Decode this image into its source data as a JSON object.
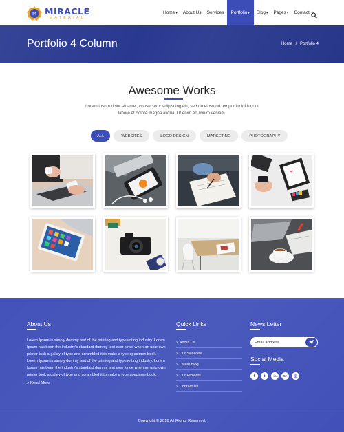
{
  "brand": {
    "name": "MIRACLE",
    "tagline": "MATERIAL",
    "badge_letter": "M"
  },
  "nav": {
    "items": [
      {
        "label": "Home",
        "caret": true,
        "active": false
      },
      {
        "label": "About Us",
        "caret": false,
        "active": false
      },
      {
        "label": "Services",
        "caret": false,
        "active": false
      },
      {
        "label": "Portfolio",
        "caret": true,
        "active": true
      },
      {
        "label": "Blog",
        "caret": true,
        "active": false
      },
      {
        "label": "Pages",
        "caret": true,
        "active": false
      },
      {
        "label": "Contact",
        "caret": false,
        "active": false
      }
    ],
    "search_icon": "search-icon"
  },
  "banner": {
    "title": "Portfolio 4 Column",
    "breadcrumb_home": "Home",
    "breadcrumb_sep": "/",
    "breadcrumb_current": "Portfolio 4"
  },
  "works": {
    "title": "Awesome Works",
    "intro": "Lorem ipsum dolor sit amet, consectetur adipiscing elit, sed do eiusmod tempor incididunt ut labore et dolore magna aliqua. Ut enim ad minim veniam.",
    "filters": [
      {
        "label": "ALL",
        "active": true
      },
      {
        "label": "WEBSITES",
        "active": false
      },
      {
        "label": "LOGO DESIGN",
        "active": false
      },
      {
        "label": "MARKETING",
        "active": false
      },
      {
        "label": "PHOTOGRAPHY",
        "active": false
      }
    ],
    "items": [
      {
        "name": "portfolio-item-laptop-phone"
      },
      {
        "name": "portfolio-item-phone-earbuds"
      },
      {
        "name": "portfolio-item-writing-notebook"
      },
      {
        "name": "portfolio-item-desk-notebook"
      },
      {
        "name": "portfolio-item-tablet-keyboard"
      },
      {
        "name": "portfolio-item-camera"
      },
      {
        "name": "portfolio-item-desk-chair"
      },
      {
        "name": "portfolio-item-coffee-laptop"
      }
    ]
  },
  "footer": {
    "about_heading": "About Us",
    "about_text": "Lorem Ipsum is simply dummy text of the printing and typesetting industry. Lorem Ipsum has been the industry's standard dummy text ever since when an unknown printer took a galley of type and scrambled it to make a type specimen book. Lorem Ipsum is simply dummy text of the printing and typesetting industry. Lorem Ipsum has been the industry's standard dummy text ever since when an unknown printer took a galley of type and scrambled it to make a type specimen book.",
    "read_more": "Read More",
    "links_heading": "Quick Links",
    "links": [
      "About Us",
      "Our Services",
      "Latest Blog",
      "Our Projects",
      "Contact Us"
    ],
    "newsletter_heading": "News Letter",
    "newsletter_placeholder": "Email Address",
    "social_heading": "Social Media",
    "social": [
      {
        "icon": "facebook-icon",
        "glyph": "f"
      },
      {
        "icon": "twitter-icon",
        "glyph": "t"
      },
      {
        "icon": "linkedin-icon",
        "glyph": "in"
      },
      {
        "icon": "google-plus-icon",
        "glyph": "G+"
      },
      {
        "icon": "instagram-icon",
        "glyph": "◎"
      }
    ],
    "copyright": "Copyright © 2018 All Rights Reserved."
  },
  "colors": {
    "primary": "#3d4db7",
    "banner": "#2a3990",
    "accent": "#e9a22b"
  }
}
